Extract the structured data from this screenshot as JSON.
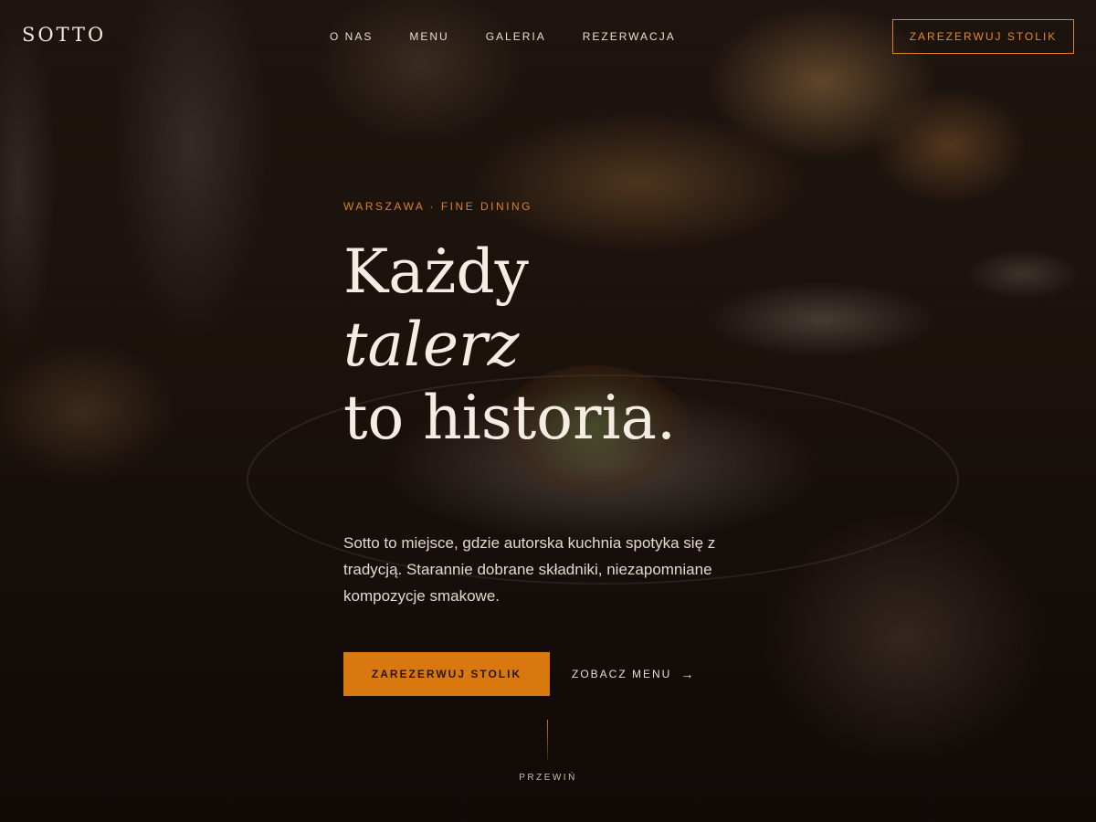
{
  "brand": {
    "logo": "SOTTO"
  },
  "nav": {
    "links": [
      "O NAS",
      "MENU",
      "GALERIA",
      "REZERWACJA"
    ],
    "cta": "ZAREZERWUJ STOLIK"
  },
  "hero": {
    "eyebrow": "WARSZAWA · FINE DINING",
    "headline": {
      "line1": "Każdy",
      "line2": "talerz",
      "line3": "to historia."
    },
    "lede": "Sotto to miejsce, gdzie autorska kuchnia spotyka się z tradycją. Starannie dobrane składniki, niezapomniane kompozycje smakowe.",
    "primary_button": "ZAREZERWUJ STOLIK",
    "secondary_link": "ZOBACZ MENU",
    "secondary_icon": "arrow-right-icon",
    "scroll_label": "PRZEWIŃ"
  },
  "colors": {
    "accent": "#d9780f",
    "accent_text": "#d9822a",
    "text_light": "#f5ede3"
  }
}
